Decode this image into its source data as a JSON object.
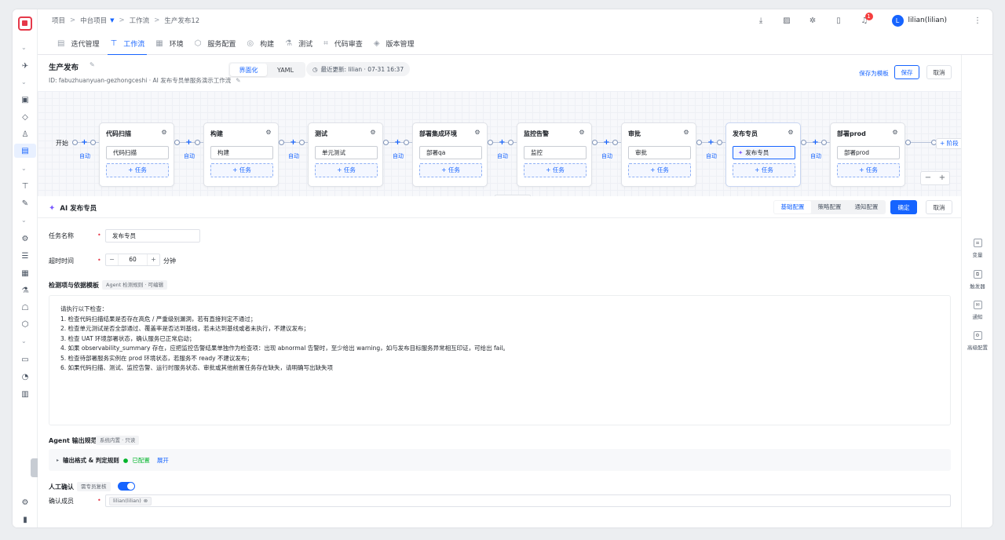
{
  "breadcrumb": {
    "items": [
      "项目",
      "中台项目",
      "工作流",
      "生产发布12"
    ]
  },
  "topbar": {
    "user_avatar_letter": "L",
    "user_name": "lilian(lilian)",
    "notification_count": "1"
  },
  "nav_tabs": [
    {
      "label": "迭代管理",
      "icon": "iteration-icon"
    },
    {
      "label": "工作流",
      "icon": "workflow-icon",
      "active": true
    },
    {
      "label": "环境",
      "icon": "environment-icon"
    },
    {
      "label": "服务配置",
      "icon": "service-config-icon"
    },
    {
      "label": "构建",
      "icon": "build-icon"
    },
    {
      "label": "测试",
      "icon": "test-icon"
    },
    {
      "label": "代码审查",
      "icon": "code-review-icon"
    },
    {
      "label": "版本管理",
      "icon": "version-icon"
    }
  ],
  "header": {
    "title": "生产发布",
    "id_line": "ID: fabuzhuanyuan-gezhongceshi · AI 发布专员单服务演示工作流",
    "view_modes": [
      "界面化",
      "YAML"
    ],
    "last_update": "最近更新: lilian · 07-31 16:37",
    "save_template": "保存为模板",
    "save": "保存",
    "cancel": "取消"
  },
  "pipeline": {
    "start_label": "开始",
    "auto_label": "自动",
    "add_task_label": "+ 任务",
    "add_stage_label": "+ 阶段",
    "stages": [
      {
        "name": "代码扫描",
        "job": "代码扫描"
      },
      {
        "name": "构建",
        "job": "构建"
      },
      {
        "name": "测试",
        "job": "单元测试"
      },
      {
        "name": "部署集成环境",
        "job": "部署qa"
      },
      {
        "name": "监控告警",
        "job": "监控"
      },
      {
        "name": "审批",
        "job": "审批"
      },
      {
        "name": "发布专员",
        "job": "发布专员",
        "selected": true
      },
      {
        "name": "部署prod",
        "job": "部署prod"
      }
    ],
    "zoom": {
      "minus": "−",
      "plus": "+"
    }
  },
  "panel": {
    "title": "AI 发布专员",
    "tabs": [
      "基础配置",
      "策略配置",
      "通知配置"
    ],
    "confirm": "确定",
    "cancel": "取消",
    "task_name_label": "任务名称",
    "task_name_value": "发布专员",
    "timeout_label": "超时时间",
    "timeout_value": "60",
    "timeout_unit": "分钟",
    "check_section_title": "检测项与依据模板",
    "check_section_tag": "Agent 检测规则 · 可编辑",
    "check_lines": [
      "请执行以下检查：",
      "1. 检查代码扫描结果是否存在高危 / 严重级别漏洞，若有直接判定不通过；",
      "2. 检查单元测试是否全部通过、覆盖率是否达到基线，若未达到基线或者未执行，不建议发布；",
      "3. 检查 UAT 环境部署状态，确认服务已正常启动；",
      "4. 如果 observability_summary 存在，应把监控告警结果单独作为检查项：出现 abnormal 告警时，至少给出 warning，如与发布目标服务异常相互印证，可给出 fail。",
      "5. 检查待部署服务实例在 prod 环境状态，若服务不 ready 不建议发布；",
      "6. 如果代码扫描、测试、监控告警、运行时服务状态、审批或其他前置任务存在缺失，请明确写出缺失项"
    ],
    "output_section_title": "Agent 输出规范",
    "output_section_tag": "系统内置 · 只读",
    "output_rule_label": "输出格式 & 判定规则",
    "output_rule_status": "已配置",
    "output_rule_expand": "展开",
    "manual_confirm_label": "人工确认",
    "manual_confirm_tag": "需专员复核",
    "manual_confirm_on": true,
    "confirm_members_label": "确认成员",
    "confirm_member_chip": "lilian(lilian)"
  },
  "right_sidebar": [
    {
      "label": "变量",
      "icon": "variable-icon"
    },
    {
      "label": "触发器",
      "icon": "trigger-icon"
    },
    {
      "label": "通知",
      "icon": "notification-icon"
    },
    {
      "label": "高级配置",
      "icon": "advanced-config-icon"
    }
  ],
  "colors": {
    "accent": "#1664ff",
    "brand": "#e5394a",
    "success": "#00b42a"
  }
}
